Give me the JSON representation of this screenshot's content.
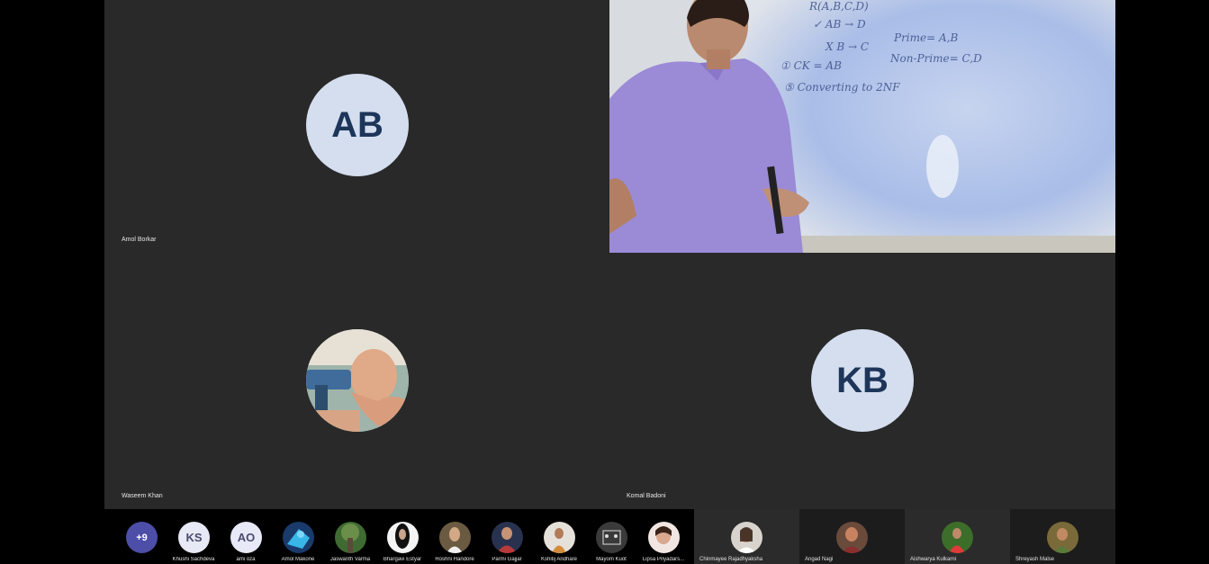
{
  "tiles": {
    "top_left": {
      "name": "Amol Borkar",
      "initials": "AB"
    },
    "top_right": {
      "board_lines": [
        "R(A,B,C,D)",
        "✓ AB → D",
        "X B → C",
        "Prime= A,B",
        "① CK = AB",
        "Non-Prime= C,D",
        "⑤ Converting to 2NF"
      ]
    },
    "bottom_left": {
      "name": "Waseem Khan"
    },
    "bottom_right": {
      "name": "Komal Badoni",
      "initials": "KB"
    }
  },
  "strip": {
    "more_count": "+9",
    "participants": [
      {
        "name": "Khushi Sachdeva",
        "initials": "KS"
      },
      {
        "name": "ami oza",
        "initials": "AO"
      },
      {
        "name": "Amol Makone"
      },
      {
        "name": "Jaswanth Varma"
      },
      {
        "name": "Bhargavi Estyar"
      },
      {
        "name": "Roshni Handore"
      },
      {
        "name": "Parmi Gajjar"
      },
      {
        "name": "Kshitij Andhare"
      },
      {
        "name": "Mayom Kuot"
      },
      {
        "name": "Lipsa Priyadars..."
      }
    ],
    "video_participants": [
      {
        "name": "Chinmayee Rajadhyaksha"
      },
      {
        "name": "Angad Nagi"
      },
      {
        "name": "Aishwarya Kulkarni"
      },
      {
        "name": "Shreyash Malse"
      }
    ]
  }
}
